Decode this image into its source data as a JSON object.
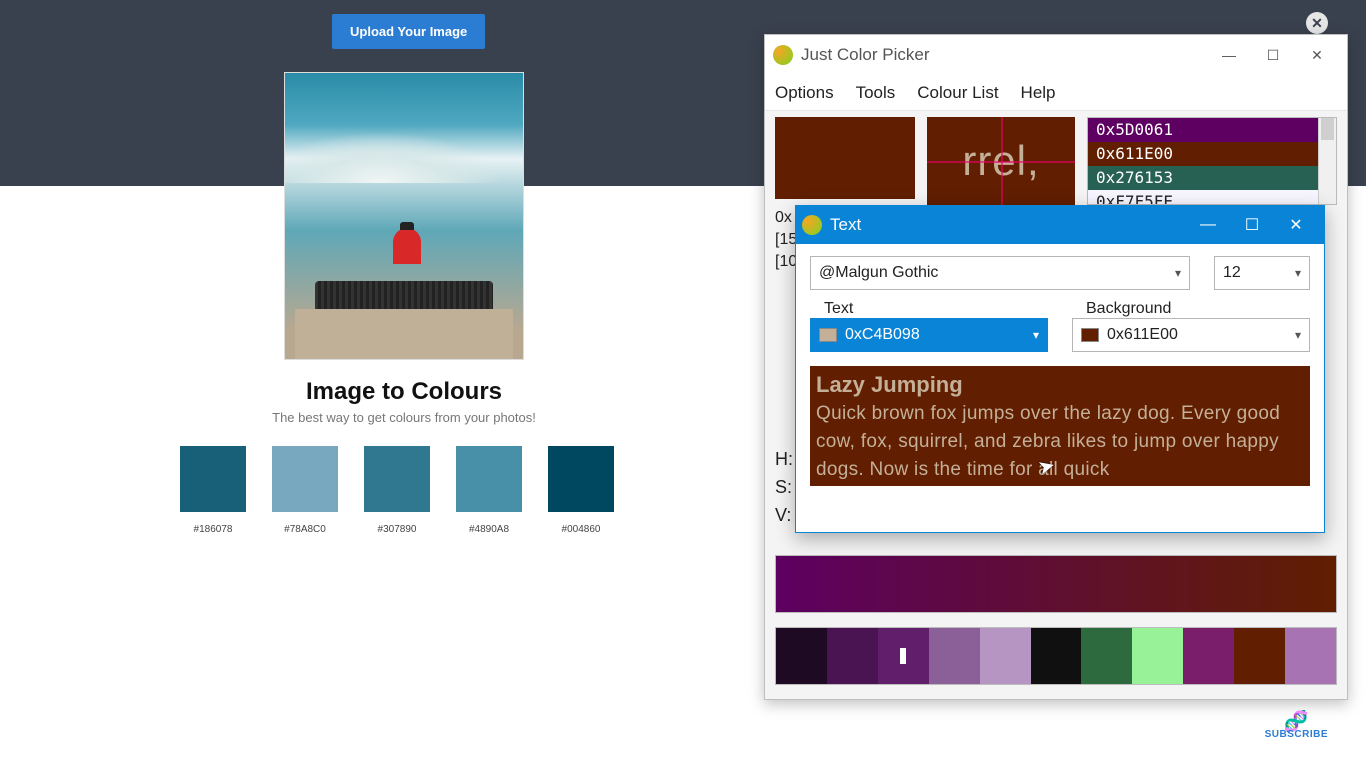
{
  "page": {
    "upload_label": "Upload Your Image",
    "title": "Image to Colours",
    "subtitle": "The best way to get colours from your photos!",
    "swatches": [
      {
        "hex": "#186078"
      },
      {
        "hex": "#78A8C0"
      },
      {
        "hex": "#307890"
      },
      {
        "hex": "#4890A8"
      },
      {
        "hex": "#004860"
      }
    ],
    "close_x": "✕"
  },
  "subscribe": {
    "label": "SUBSCRIBE"
  },
  "jcp": {
    "title": "Just Color Picker",
    "menu": [
      "Options",
      "Tools",
      "Colour List",
      "Help"
    ],
    "swatch_hex": "#611E00",
    "zoom_text": "rrel,",
    "colorlist": [
      {
        "hex": "0x5D0061",
        "bg": "#5D0061"
      },
      {
        "hex": "0x611E00",
        "bg": "#611E00"
      },
      {
        "hex": "0x276153",
        "bg": "#276153"
      },
      {
        "hex": "0xF7F5FE",
        "bg": "#F7F5FE"
      }
    ],
    "info_lines": [
      "0x",
      "[15",
      "[10"
    ],
    "hsv_labels": [
      "H:",
      "S:",
      "V:"
    ],
    "hint_prefix": "H",
    "gradient_from": "#5D0061",
    "gradient_to": "#611E00",
    "palette": [
      "#1e0a22",
      "#4a1452",
      "#611e6b",
      "#8b5f97",
      "#b795c2",
      "#101010",
      "#2d6b3f",
      "#98f298",
      "#7a1e6b",
      "#611E00",
      "#a873b3"
    ],
    "palette_marker_index": 2,
    "win_btns": {
      "min": "—",
      "max": "☐",
      "close": "✕"
    }
  },
  "text_win": {
    "title": "Text",
    "font": "@Malgun Gothic",
    "size": "12",
    "text_label": "Text",
    "bg_label": "Background",
    "text_value": "0xC4B098",
    "text_swatch": "#C4B098",
    "bg_value": "0x611E00",
    "bg_swatch": "#611E00",
    "preview_heading": "Lazy Jumping",
    "preview_body": "Quick brown fox jumps over the lazy dog. Every good cow, fox, squirrel, and zebra likes to jump over happy dogs. Now is the time for all quick",
    "win_btns": {
      "min": "—",
      "max": "☐",
      "close": "✕"
    }
  }
}
